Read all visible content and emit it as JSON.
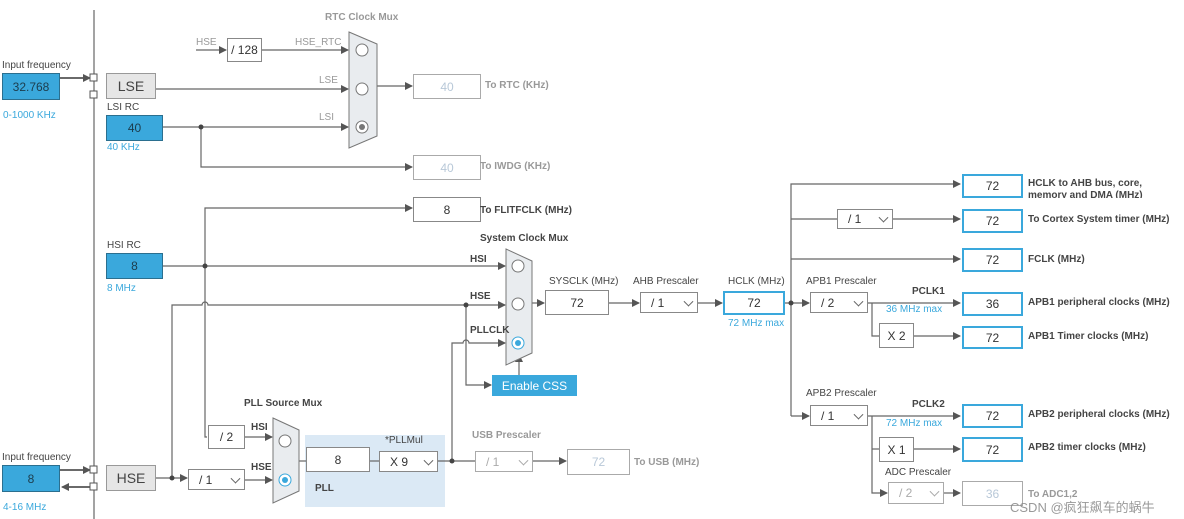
{
  "lse_input": {
    "label": "Input frequency",
    "value": "32.768",
    "range": "0-1000 KHz",
    "block": "LSE"
  },
  "lsi": {
    "label": "LSI RC",
    "value": "40",
    "unit": "40 KHz"
  },
  "hsi": {
    "label": "HSI RC",
    "value": "8",
    "unit": "8 MHz"
  },
  "hse_input": {
    "label": "Input frequency",
    "value": "8",
    "range": "4-16 MHz",
    "block": "HSE"
  },
  "rtc_mux": {
    "title": "RTC Clock Mux",
    "hse": "HSE",
    "div": "/ 128",
    "hse_rtc": "HSE_RTC",
    "lse": "LSE",
    "lsi": "LSI",
    "selected": "LSI"
  },
  "rtc_out": {
    "value": "40",
    "label": "To RTC (KHz)"
  },
  "iwdg_out": {
    "value": "40",
    "label": "To IWDG (KHz)"
  },
  "flitf_out": {
    "value": "8",
    "label": "To FLITFCLK (MHz)"
  },
  "sys_mux": {
    "title": "System Clock Mux",
    "hsi": "HSI",
    "hse": "HSE",
    "pllclk": "PLLCLK",
    "selected": "PLLCLK"
  },
  "css_button": "Enable CSS",
  "sysclk": {
    "label": "SYSCLK (MHz)",
    "value": "72"
  },
  "ahb": {
    "label": "AHB Prescaler",
    "value": "/ 1"
  },
  "hclk": {
    "label": "HCLK (MHz)",
    "value": "72",
    "max": "72 MHz max"
  },
  "outputs": {
    "ahb_bus": {
      "value": "72",
      "label": "HCLK to AHB bus, core, memory and DMA (MHz)"
    },
    "cortex_div": "/ 1",
    "cortex": {
      "value": "72",
      "label": "To Cortex System timer (MHz)"
    },
    "fclk": {
      "value": "72",
      "label": "FCLK (MHz)"
    }
  },
  "apb1": {
    "label": "APB1 Prescaler",
    "value": "/ 2",
    "pclk": "PCLK1",
    "max": "36 MHz max",
    "periph": "36",
    "periph_label": "APB1 peripheral clocks (MHz)",
    "mult": "X 2",
    "timer": "72",
    "timer_label": "APB1 Timer clocks (MHz)"
  },
  "apb2": {
    "label": "APB2 Prescaler",
    "value": "/ 1",
    "pclk": "PCLK2",
    "max": "72 MHz max",
    "periph": "72",
    "periph_label": "APB2 peripheral clocks (MHz)",
    "mult": "X 1",
    "timer": "72",
    "timer_label": "APB2 timer clocks (MHz)"
  },
  "adc": {
    "label": "ADC Prescaler",
    "value": "/ 2",
    "out": "36",
    "out_label": "To ADC1,2"
  },
  "pll_mux": {
    "title": "PLL Source Mux",
    "hsi_div": "/ 2",
    "hsi": "HSI",
    "hse": "HSE",
    "hse_div": "/ 1",
    "selected": "HSE"
  },
  "pll": {
    "label": "PLL",
    "value": "8",
    "mul_label": "*PLLMul",
    "mul": "X 9"
  },
  "usb": {
    "label": "USB Prescaler",
    "value": "/ 1",
    "out": "72",
    "out_label": "To USB (MHz)"
  },
  "watermark": "CSDN @疯狂飙车的蜗牛",
  "colors": {
    "accent": "#3aa8dc",
    "pll_bg": "#dbe9f5"
  }
}
